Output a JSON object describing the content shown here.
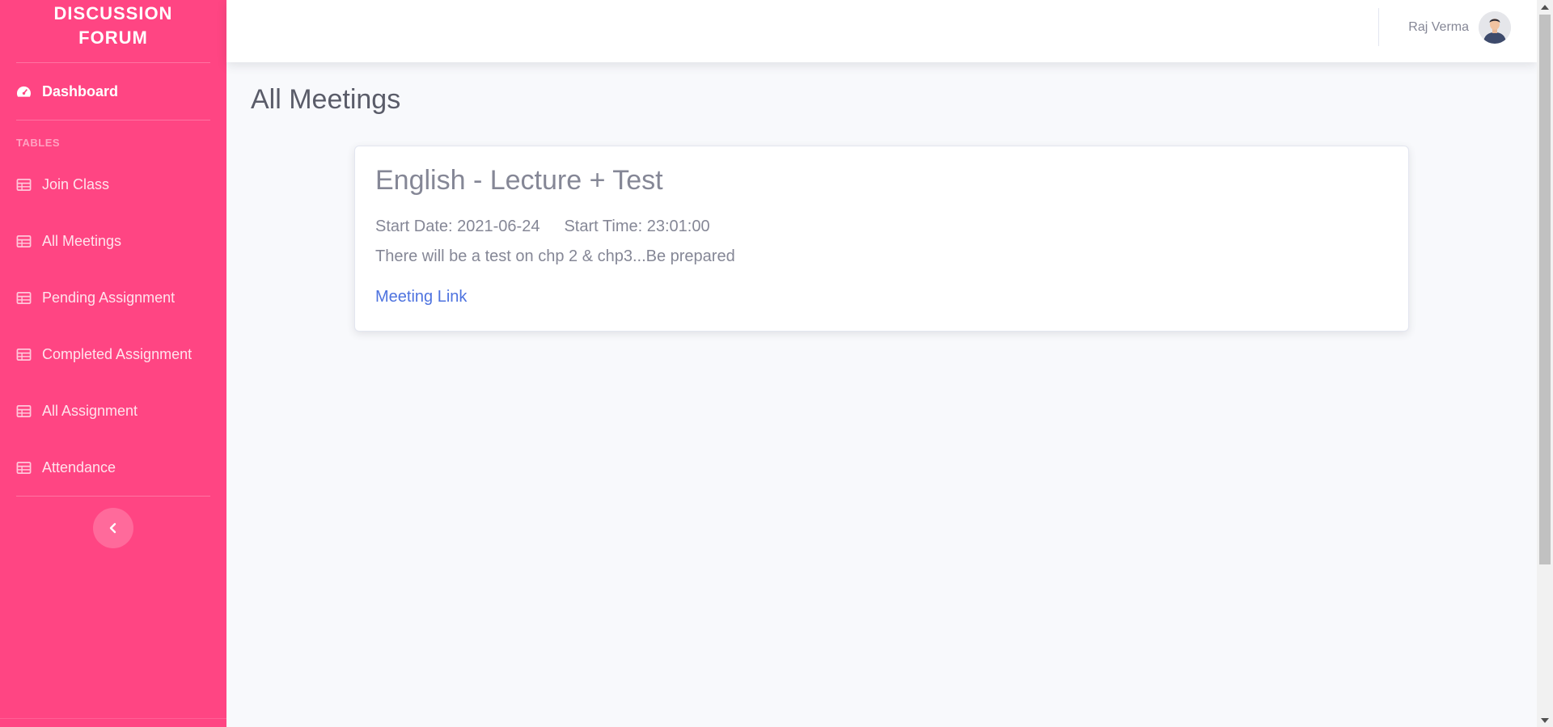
{
  "sidebar": {
    "brand_line1": "DISCUSSION",
    "brand_line2": "FORUM",
    "dashboard": "Dashboard",
    "heading": "TABLES",
    "items": [
      {
        "label": "Join Class"
      },
      {
        "label": "All Meetings"
      },
      {
        "label": "Pending Assignment"
      },
      {
        "label": "Completed Assignment"
      },
      {
        "label": "All Assignment"
      },
      {
        "label": "Attendance"
      }
    ],
    "toggle_icon": "chevron-left-icon"
  },
  "topbar": {
    "user_name": "Raj Verma",
    "avatar_icon": "user-avatar"
  },
  "main": {
    "page_title": "All Meetings",
    "meeting": {
      "title": "English - Lecture + Test",
      "start_date": "Start Date: 2021-06-24",
      "start_time": "Start Time: 23:01:00",
      "description": "There will be a test on chp 2 & chp3...Be prepared",
      "link_label": "Meeting Link"
    }
  },
  "colors": {
    "sidebar_bg": "#ff4583",
    "page_bg": "#f8f9fc",
    "link": "#4e73df",
    "text_muted": "#858796"
  }
}
